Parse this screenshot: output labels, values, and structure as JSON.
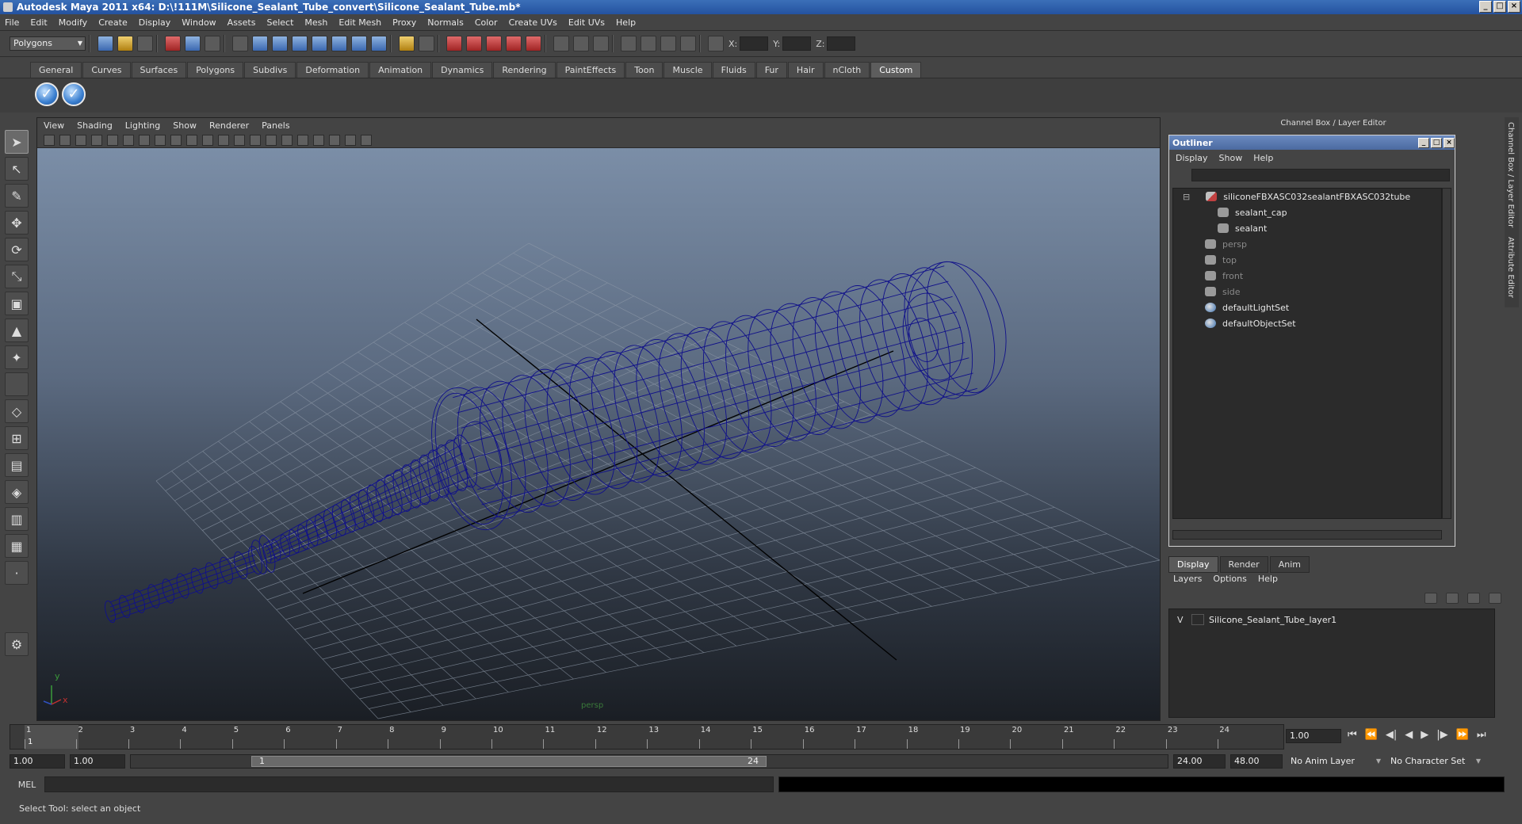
{
  "window": {
    "title": "Autodesk Maya 2011 x64: D:\\!111M\\Silicone_Sealant_Tube_convert\\Silicone_Sealant_Tube.mb*"
  },
  "menubar": [
    "File",
    "Edit",
    "Modify",
    "Create",
    "Display",
    "Window",
    "Assets",
    "Select",
    "Mesh",
    "Edit Mesh",
    "Proxy",
    "Normals",
    "Color",
    "Create UVs",
    "Edit UVs",
    "Help"
  ],
  "statusline": {
    "mode": "Polygons",
    "x_label": "X:",
    "y_label": "Y:",
    "z_label": "Z:"
  },
  "shelf": {
    "tabs": [
      "General",
      "Curves",
      "Surfaces",
      "Polygons",
      "Subdivs",
      "Deformation",
      "Animation",
      "Dynamics",
      "Rendering",
      "PaintEffects",
      "Toon",
      "Muscle",
      "Fluids",
      "Fur",
      "Hair",
      "nCloth",
      "Custom"
    ],
    "active_tab": "Custom"
  },
  "viewport": {
    "menus": [
      "View",
      "Shading",
      "Lighting",
      "Show",
      "Renderer",
      "Panels"
    ],
    "camera_label": "persp",
    "axis_y": "y",
    "axis_x": "x"
  },
  "right_panel": {
    "header": "Channel Box / Layer Editor",
    "side_tab_1": "Channel Box / Layer Editor",
    "side_tab_2": "Attribute Editor"
  },
  "outliner": {
    "title": "Outliner",
    "menus": [
      "Display",
      "Show",
      "Help"
    ],
    "items": [
      {
        "label": "siliconeFBXASC032sealantFBXASC032tube",
        "icon": "mesh",
        "indent": 0,
        "dim": false
      },
      {
        "label": "sealant_cap",
        "icon": "transform",
        "indent": 1,
        "dim": false
      },
      {
        "label": "sealant",
        "icon": "transform",
        "indent": 1,
        "dim": false
      },
      {
        "label": "persp",
        "icon": "camera",
        "indent": 0,
        "dim": true
      },
      {
        "label": "top",
        "icon": "camera",
        "indent": 0,
        "dim": true
      },
      {
        "label": "front",
        "icon": "camera",
        "indent": 0,
        "dim": true
      },
      {
        "label": "side",
        "icon": "camera",
        "indent": 0,
        "dim": true
      },
      {
        "label": "defaultLightSet",
        "icon": "set",
        "indent": 0,
        "dim": false
      },
      {
        "label": "defaultObjectSet",
        "icon": "set",
        "indent": 0,
        "dim": false
      }
    ]
  },
  "layer_editor": {
    "tabs": [
      "Display",
      "Render",
      "Anim"
    ],
    "active_tab": "Display",
    "menus": [
      "Layers",
      "Options",
      "Help"
    ],
    "layers": [
      {
        "visible": "V",
        "name": "Silicone_Sealant_Tube_layer1"
      }
    ]
  },
  "timeline": {
    "frames": [
      1,
      2,
      3,
      4,
      5,
      6,
      7,
      8,
      9,
      10,
      11,
      12,
      13,
      14,
      15,
      16,
      17,
      18,
      19,
      20,
      21,
      22,
      23,
      24
    ],
    "current_frame_field": "1.00",
    "current_frame_marker": "1"
  },
  "range": {
    "start": "1.00",
    "playback_start": "1.00",
    "slider_left": "1",
    "slider_right": "24",
    "playback_end": "24.00",
    "end": "48.00",
    "anim_layer": "No Anim Layer",
    "character_set": "No Character Set"
  },
  "command": {
    "label": "MEL"
  },
  "help_line": "Select Tool: select an object"
}
